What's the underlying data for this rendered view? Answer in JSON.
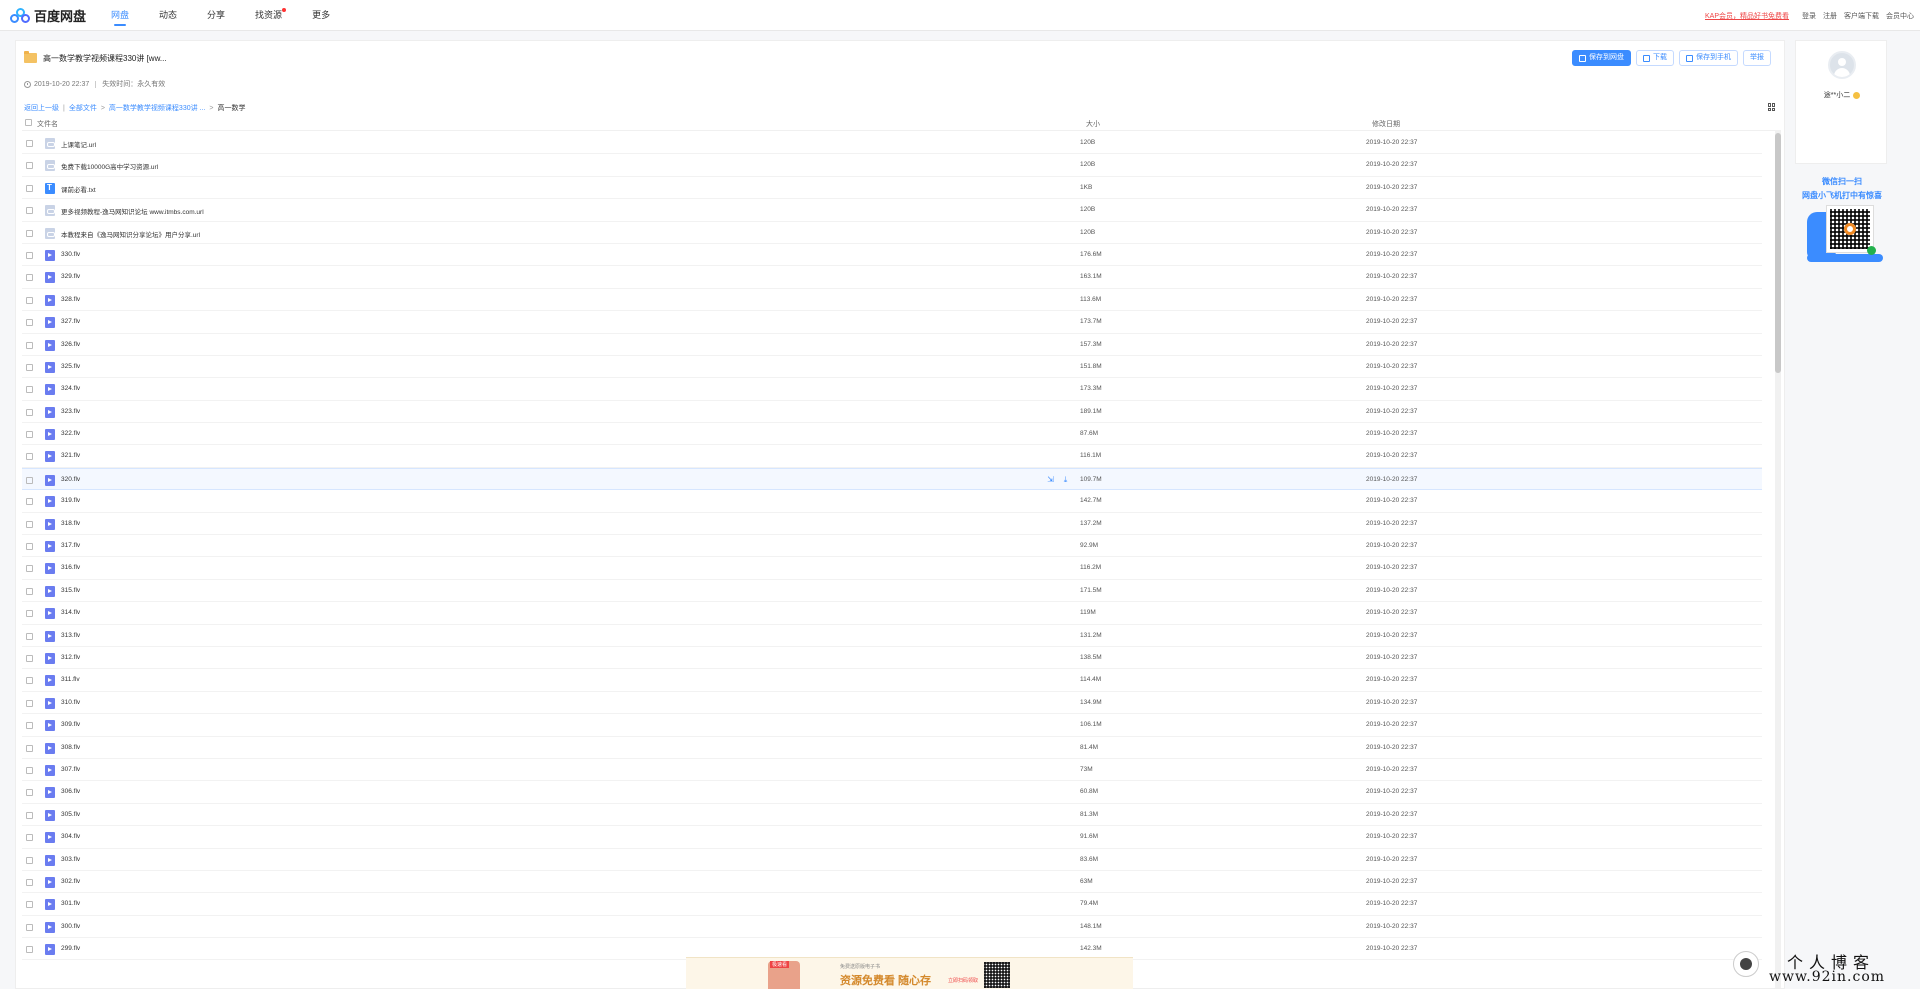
{
  "header": {
    "logo_text": "百度网盘",
    "nav": [
      {
        "label": "网盘",
        "active": true
      },
      {
        "label": "动态",
        "active": false
      },
      {
        "label": "分享",
        "active": false
      },
      {
        "label": "找资源",
        "active": false,
        "dot": true
      },
      {
        "label": "更多",
        "active": false
      }
    ],
    "promo_link": "KAP会员，精品好书免费看",
    "links": [
      "登录",
      "注册",
      "客户端下载",
      "会员中心"
    ]
  },
  "share": {
    "title": "高一数学教学视频课程330讲 [ww...",
    "created": "2019-10-20 22:37",
    "expire": "失效时间：永久有效"
  },
  "actions": {
    "save": "保存到网盘",
    "download": "下载",
    "save_phone": "保存到手机",
    "report": "举报"
  },
  "breadcrumb": {
    "back": "返回上一级",
    "all": "全部文件",
    "parent": "高一数学教学视频课程330讲 ...",
    "current": "高一数学"
  },
  "columns": {
    "name": "文件名",
    "size": "大小",
    "date": "修改日期"
  },
  "files": [
    {
      "name": "上课笔记.url",
      "size": "120B",
      "date": "2019-10-20 22:37",
      "type": "link"
    },
    {
      "name": "免费下载10000G高中学习资源.url",
      "size": "120B",
      "date": "2019-10-20 22:37",
      "type": "link"
    },
    {
      "name": "课前必看.txt",
      "size": "1KB",
      "date": "2019-10-20 22:37",
      "type": "text"
    },
    {
      "name": "更多视频教程-逸马网知识论坛 www.itmbs.com.url",
      "size": "120B",
      "date": "2019-10-20 22:37",
      "type": "link"
    },
    {
      "name": "本教程来自《逸马网知识分享论坛》用户分享.url",
      "size": "120B",
      "date": "2019-10-20 22:37",
      "type": "link"
    },
    {
      "name": "330.flv",
      "size": "176.6M",
      "date": "2019-10-20 22:37",
      "type": "video"
    },
    {
      "name": "329.flv",
      "size": "163.1M",
      "date": "2019-10-20 22:37",
      "type": "video"
    },
    {
      "name": "328.flv",
      "size": "113.6M",
      "date": "2019-10-20 22:37",
      "type": "video"
    },
    {
      "name": "327.flv",
      "size": "173.7M",
      "date": "2019-10-20 22:37",
      "type": "video"
    },
    {
      "name": "326.flv",
      "size": "157.3M",
      "date": "2019-10-20 22:37",
      "type": "video"
    },
    {
      "name": "325.flv",
      "size": "151.8M",
      "date": "2019-10-20 22:37",
      "type": "video"
    },
    {
      "name": "324.flv",
      "size": "173.3M",
      "date": "2019-10-20 22:37",
      "type": "video"
    },
    {
      "name": "323.flv",
      "size": "189.1M",
      "date": "2019-10-20 22:37",
      "type": "video"
    },
    {
      "name": "322.flv",
      "size": "87.6M",
      "date": "2019-10-20 22:37",
      "type": "video"
    },
    {
      "name": "321.flv",
      "size": "116.1M",
      "date": "2019-10-20 22:37",
      "type": "video"
    },
    {
      "name": "320.flv",
      "size": "109.7M",
      "date": "2019-10-20 22:37",
      "type": "video",
      "hover": true
    },
    {
      "name": "319.flv",
      "size": "142.7M",
      "date": "2019-10-20 22:37",
      "type": "video"
    },
    {
      "name": "318.flv",
      "size": "137.2M",
      "date": "2019-10-20 22:37",
      "type": "video"
    },
    {
      "name": "317.flv",
      "size": "92.9M",
      "date": "2019-10-20 22:37",
      "type": "video"
    },
    {
      "name": "316.flv",
      "size": "116.2M",
      "date": "2019-10-20 22:37",
      "type": "video"
    },
    {
      "name": "315.flv",
      "size": "171.5M",
      "date": "2019-10-20 22:37",
      "type": "video"
    },
    {
      "name": "314.flv",
      "size": "119M",
      "date": "2019-10-20 22:37",
      "type": "video"
    },
    {
      "name": "313.flv",
      "size": "131.2M",
      "date": "2019-10-20 22:37",
      "type": "video"
    },
    {
      "name": "312.flv",
      "size": "138.5M",
      "date": "2019-10-20 22:37",
      "type": "video"
    },
    {
      "name": "311.flv",
      "size": "114.4M",
      "date": "2019-10-20 22:37",
      "type": "video"
    },
    {
      "name": "310.flv",
      "size": "134.9M",
      "date": "2019-10-20 22:37",
      "type": "video"
    },
    {
      "name": "309.flv",
      "size": "106.1M",
      "date": "2019-10-20 22:37",
      "type": "video"
    },
    {
      "name": "308.flv",
      "size": "81.4M",
      "date": "2019-10-20 22:37",
      "type": "video"
    },
    {
      "name": "307.flv",
      "size": "73M",
      "date": "2019-10-20 22:37",
      "type": "video"
    },
    {
      "name": "306.flv",
      "size": "60.8M",
      "date": "2019-10-20 22:37",
      "type": "video"
    },
    {
      "name": "305.flv",
      "size": "81.3M",
      "date": "2019-10-20 22:37",
      "type": "video"
    },
    {
      "name": "304.flv",
      "size": "91.6M",
      "date": "2019-10-20 22:37",
      "type": "video"
    },
    {
      "name": "303.flv",
      "size": "83.6M",
      "date": "2019-10-20 22:37",
      "type": "video"
    },
    {
      "name": "302.flv",
      "size": "63M",
      "date": "2019-10-20 22:37",
      "type": "video"
    },
    {
      "name": "301.flv",
      "size": "79.4M",
      "date": "2019-10-20 22:37",
      "type": "video"
    },
    {
      "name": "300.flv",
      "size": "148.1M",
      "date": "2019-10-20 22:37",
      "type": "video"
    },
    {
      "name": "299.flv",
      "size": "142.3M",
      "date": "2019-10-20 22:37",
      "type": "video"
    }
  ],
  "sidebar": {
    "username": "途**小二",
    "promo_line1": "微信扫一扫",
    "promo_line2": "网盘小飞机打中有惊喜"
  },
  "ad": {
    "tag": "极速看",
    "small": "免费送原版电子书",
    "big": "资源免费看  随心存",
    "cta": "立即扫码领取"
  },
  "watermark": {
    "cn": "个人博客",
    "url": "www.92in.com"
  },
  "colors": {
    "accent": "#3b8cff",
    "video_icon": "#6a7cf0",
    "folder": "#f4c263"
  }
}
